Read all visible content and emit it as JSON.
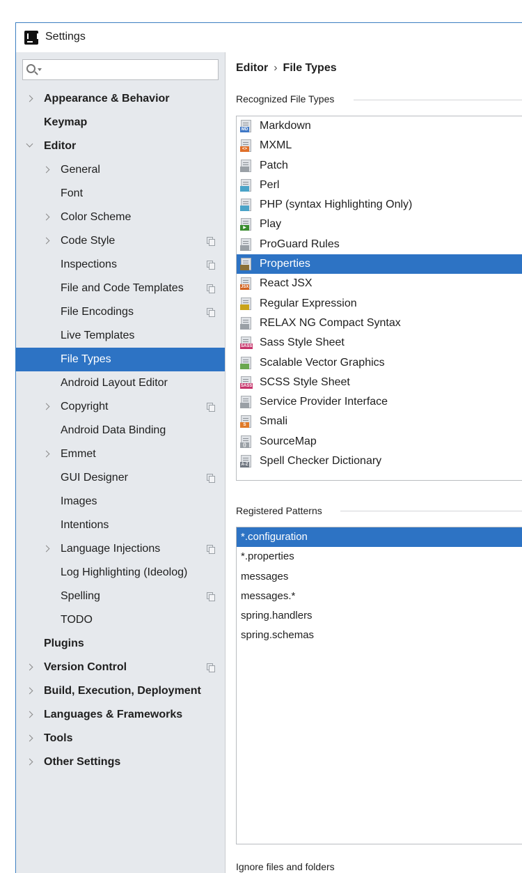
{
  "window": {
    "title": "Settings"
  },
  "search": {
    "placeholder": "",
    "value": ""
  },
  "sidebar": {
    "items": [
      {
        "label": "Appearance & Behavior",
        "level": 0,
        "bold": true,
        "arrow": "right",
        "copy": false,
        "selected": false
      },
      {
        "label": "Keymap",
        "level": 0,
        "bold": true,
        "arrow": "none",
        "copy": false,
        "selected": false
      },
      {
        "label": "Editor",
        "level": 0,
        "bold": true,
        "arrow": "down",
        "copy": false,
        "selected": false
      },
      {
        "label": "General",
        "level": 1,
        "bold": false,
        "arrow": "right",
        "copy": false,
        "selected": false
      },
      {
        "label": "Font",
        "level": 1,
        "bold": false,
        "arrow": "none",
        "copy": false,
        "selected": false
      },
      {
        "label": "Color Scheme",
        "level": 1,
        "bold": false,
        "arrow": "right",
        "copy": false,
        "selected": false
      },
      {
        "label": "Code Style",
        "level": 1,
        "bold": false,
        "arrow": "right",
        "copy": true,
        "selected": false
      },
      {
        "label": "Inspections",
        "level": 1,
        "bold": false,
        "arrow": "none",
        "copy": true,
        "selected": false
      },
      {
        "label": "File and Code Templates",
        "level": 1,
        "bold": false,
        "arrow": "none",
        "copy": true,
        "selected": false
      },
      {
        "label": "File Encodings",
        "level": 1,
        "bold": false,
        "arrow": "none",
        "copy": true,
        "selected": false
      },
      {
        "label": "Live Templates",
        "level": 1,
        "bold": false,
        "arrow": "none",
        "copy": false,
        "selected": false
      },
      {
        "label": "File Types",
        "level": 1,
        "bold": false,
        "arrow": "none",
        "copy": false,
        "selected": true
      },
      {
        "label": "Android Layout Editor",
        "level": 1,
        "bold": false,
        "arrow": "none",
        "copy": false,
        "selected": false
      },
      {
        "label": "Copyright",
        "level": 1,
        "bold": false,
        "arrow": "right",
        "copy": true,
        "selected": false
      },
      {
        "label": "Android Data Binding",
        "level": 1,
        "bold": false,
        "arrow": "none",
        "copy": false,
        "selected": false
      },
      {
        "label": "Emmet",
        "level": 1,
        "bold": false,
        "arrow": "right",
        "copy": false,
        "selected": false
      },
      {
        "label": "GUI Designer",
        "level": 1,
        "bold": false,
        "arrow": "none",
        "copy": true,
        "selected": false
      },
      {
        "label": "Images",
        "level": 1,
        "bold": false,
        "arrow": "none",
        "copy": false,
        "selected": false
      },
      {
        "label": "Intentions",
        "level": 1,
        "bold": false,
        "arrow": "none",
        "copy": false,
        "selected": false
      },
      {
        "label": "Language Injections",
        "level": 1,
        "bold": false,
        "arrow": "right",
        "copy": true,
        "selected": false
      },
      {
        "label": "Log Highlighting (Ideolog)",
        "level": 1,
        "bold": false,
        "arrow": "none",
        "copy": false,
        "selected": false
      },
      {
        "label": "Spelling",
        "level": 1,
        "bold": false,
        "arrow": "none",
        "copy": true,
        "selected": false
      },
      {
        "label": "TODO",
        "level": 1,
        "bold": false,
        "arrow": "none",
        "copy": false,
        "selected": false
      },
      {
        "label": "Plugins",
        "level": 0,
        "bold": true,
        "arrow": "none",
        "copy": false,
        "selected": false
      },
      {
        "label": "Version Control",
        "level": 0,
        "bold": true,
        "arrow": "right",
        "copy": true,
        "selected": false
      },
      {
        "label": "Build, Execution, Deployment",
        "level": 0,
        "bold": true,
        "arrow": "right",
        "copy": false,
        "selected": false
      },
      {
        "label": "Languages & Frameworks",
        "level": 0,
        "bold": true,
        "arrow": "right",
        "copy": false,
        "selected": false
      },
      {
        "label": "Tools",
        "level": 0,
        "bold": true,
        "arrow": "right",
        "copy": false,
        "selected": false
      },
      {
        "label": "Other Settings",
        "level": 0,
        "bold": true,
        "arrow": "right",
        "copy": false,
        "selected": false
      }
    ]
  },
  "breadcrumb": {
    "parent": "Editor",
    "separator": "›",
    "current": "File Types"
  },
  "recognized": {
    "title": "Recognized File Types",
    "items": [
      {
        "label": "Markdown",
        "icon": "markdown-file-icon",
        "badge": "MD",
        "color": "#3f78c6",
        "selected": false
      },
      {
        "label": "MXML",
        "icon": "mxml-file-icon",
        "badge": "<>",
        "color": "#e0702a",
        "selected": false
      },
      {
        "label": "Patch",
        "icon": "patch-file-icon",
        "badge": "",
        "color": "#9aa0a6",
        "selected": false
      },
      {
        "label": "Perl",
        "icon": "perl-file-icon",
        "badge": "",
        "color": "#4aa3c8",
        "selected": false
      },
      {
        "label": "PHP (syntax Highlighting Only)",
        "icon": "php-file-icon",
        "badge": "",
        "color": "#4aa3c8",
        "selected": false
      },
      {
        "label": "Play",
        "icon": "play-file-icon",
        "badge": "▶",
        "color": "#3a8d2f",
        "selected": false
      },
      {
        "label": "ProGuard Rules",
        "icon": "proguard-file-icon",
        "badge": "",
        "color": "#9aa0a6",
        "selected": false
      },
      {
        "label": "Properties",
        "icon": "properties-file-icon",
        "badge": "",
        "color": "#8a6f35",
        "selected": true
      },
      {
        "label": "React JSX",
        "icon": "jsx-file-icon",
        "badge": "JSX",
        "color": "#d2621f",
        "selected": false
      },
      {
        "label": "Regular Expression",
        "icon": "regex-file-icon",
        "badge": "",
        "color": "#c9a31a",
        "selected": false
      },
      {
        "label": "RELAX NG Compact Syntax",
        "icon": "relaxng-file-icon",
        "badge": "",
        "color": "#9aa0a6",
        "selected": false
      },
      {
        "label": "Sass Style Sheet",
        "icon": "sass-file-icon",
        "badge": "SASS",
        "color": "#c6346b",
        "selected": false
      },
      {
        "label": "Scalable Vector Graphics",
        "icon": "svg-file-icon",
        "badge": "",
        "color": "#6aa84f",
        "selected": false
      },
      {
        "label": "SCSS Style Sheet",
        "icon": "scss-file-icon",
        "badge": "SASS",
        "color": "#c6346b",
        "selected": false
      },
      {
        "label": "Service Provider Interface",
        "icon": "spi-file-icon",
        "badge": "",
        "color": "#9aa0a6",
        "selected": false
      },
      {
        "label": "Smali",
        "icon": "smali-file-icon",
        "badge": "S",
        "color": "#e07b2a",
        "selected": false
      },
      {
        "label": "SourceMap",
        "icon": "sourcemap-file-icon",
        "badge": "{}",
        "color": "#9aa0a6",
        "selected": false
      },
      {
        "label": "Spell Checker Dictionary",
        "icon": "dictionary-file-icon",
        "badge": "A-Z",
        "color": "#6f7680",
        "selected": false
      }
    ]
  },
  "patterns": {
    "title": "Registered Patterns",
    "items": [
      {
        "label": "*.configuration",
        "selected": true
      },
      {
        "label": "*.properties",
        "selected": false
      },
      {
        "label": "messages",
        "selected": false
      },
      {
        "label": "messages.*",
        "selected": false
      },
      {
        "label": "spring.handlers",
        "selected": false
      },
      {
        "label": "spring.schemas",
        "selected": false
      }
    ]
  },
  "ignore": {
    "title": "Ignore files and folders"
  },
  "colors": {
    "accent": "#2d73c4",
    "sidebar_bg": "#e6e9ed"
  }
}
